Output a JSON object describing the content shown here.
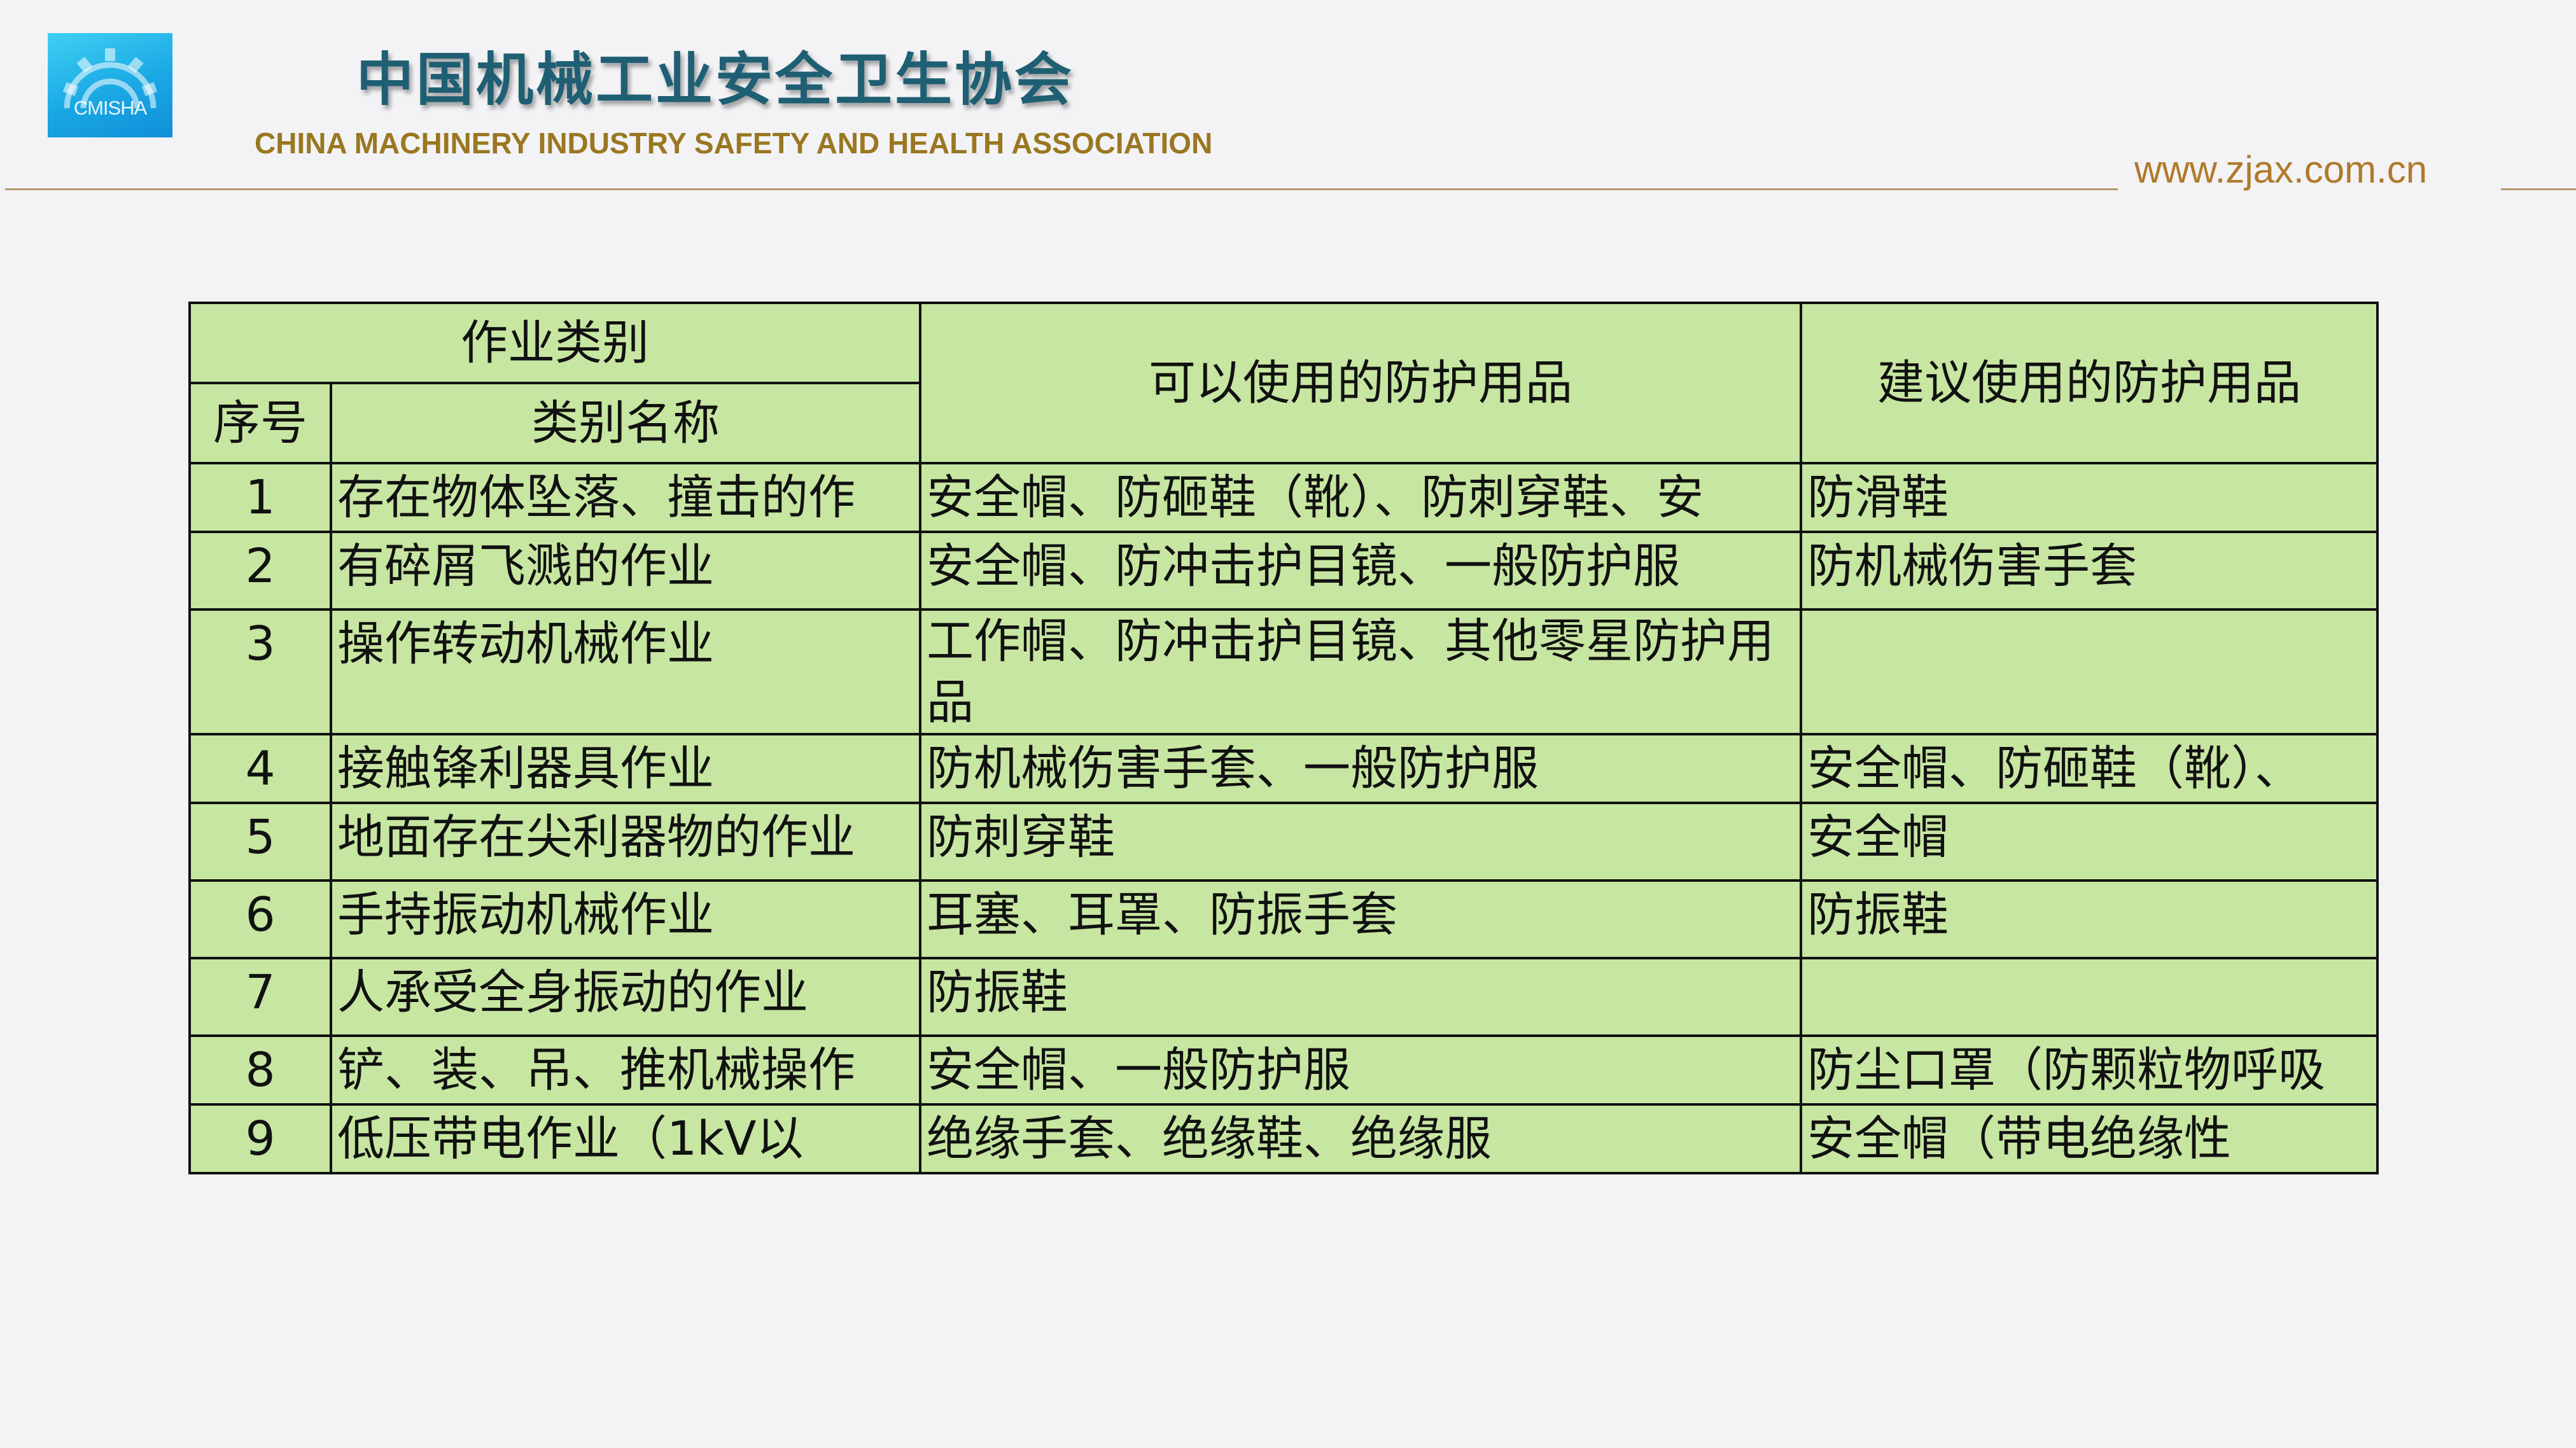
{
  "header": {
    "logo_text": "CMISHA",
    "title_cn": "中国机械工业安全卫生协会",
    "title_en": "CHINA MACHINERY INDUSTRY SAFETY AND HEALTH ASSOCIATION",
    "website": "www.zjax.com.cn"
  },
  "table": {
    "group_header": "作业类别",
    "col_no": "序号",
    "col_name": "类别名称",
    "col_usable": "可以使用的防护用品",
    "col_suggested": "建议使用的防护用品",
    "rows": [
      {
        "no": "1",
        "name": "存在物体坠落、撞击的作",
        "usable": "安全帽、防砸鞋（靴）、防刺穿鞋、安",
        "suggested": "防滑鞋"
      },
      {
        "no": "2",
        "name": "有碎屑飞溅的作业",
        "usable": "安全帽、防冲击护目镜、一般防护服",
        "suggested": "防机械伤害手套"
      },
      {
        "no": "3",
        "name": "操作转动机械作业",
        "usable": "工作帽、防冲击护目镜、其他零星防护用品",
        "suggested": ""
      },
      {
        "no": "4",
        "name": "接触锋利器具作业",
        "usable": "防机械伤害手套、一般防护服",
        "suggested": "安全帽、防砸鞋（靴）、"
      },
      {
        "no": "5",
        "name": "地面存在尖利器物的作业",
        "usable": "防刺穿鞋",
        "suggested": "安全帽"
      },
      {
        "no": "6",
        "name": "手持振动机械作业",
        "usable": "耳塞、耳罩、防振手套",
        "suggested": "防振鞋"
      },
      {
        "no": "7",
        "name": "人承受全身振动的作业",
        "usable": "防振鞋",
        "suggested": ""
      },
      {
        "no": "8",
        "name": "铲、装、吊、推机械操作",
        "usable": "安全帽、一般防护服",
        "suggested": "防尘口罩（防颗粒物呼吸"
      },
      {
        "no": "9",
        "name": "低压带电作业（1kV以",
        "usable": "绝缘手套、绝缘鞋、绝缘服",
        "suggested": "安全帽（带电绝缘性"
      }
    ]
  },
  "colors": {
    "background": "#f3f3f6",
    "table_fill": "#c7e6a1",
    "title_cn": "#1f5f73",
    "title_en": "#9a7720",
    "website": "#b07a2a",
    "logo": "#1aa8e4"
  },
  "icons": [
    "gear-logo-icon"
  ]
}
